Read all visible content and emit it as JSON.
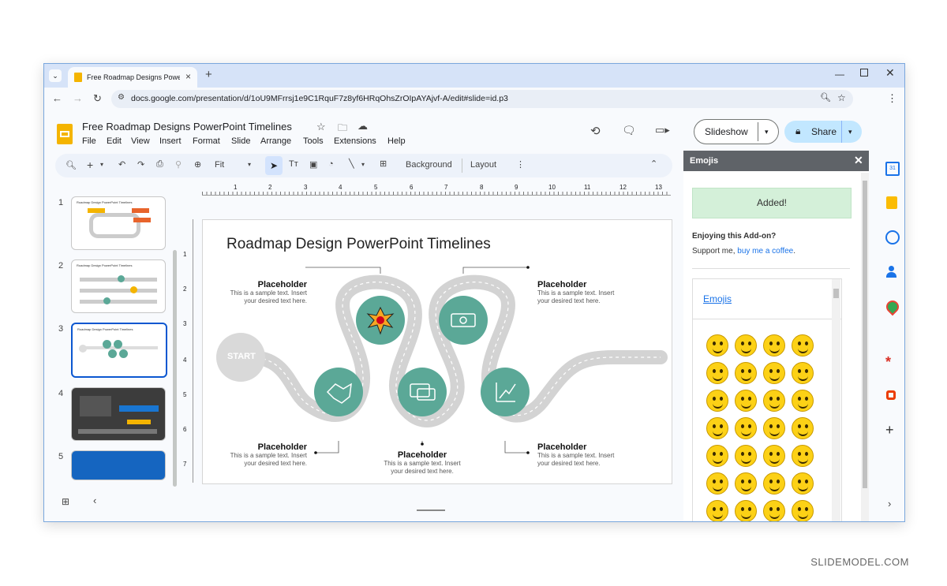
{
  "browser": {
    "tab_title": "Free Roadmap Designs PowerPoint",
    "url": "docs.google.com/presentation/d/1oU9MFrrsj1e9C1RquF7z8yf6HRqOhsZrOIpAYAjvf-A/edit#slide=id.p3"
  },
  "doc": {
    "title": "Free Roadmap Designs PowerPoint Timelines",
    "menus": [
      "File",
      "Edit",
      "View",
      "Insert",
      "Format",
      "Slide",
      "Arrange",
      "Tools",
      "Extensions",
      "Help"
    ],
    "slideshow_label": "Slideshow",
    "share_label": "Share"
  },
  "toolbar": {
    "zoom_label": "Fit",
    "background_label": "Background",
    "layout_label": "Layout"
  },
  "ruler": {
    "ticks": [
      "1",
      "2",
      "3",
      "4",
      "5",
      "6",
      "7",
      "8",
      "9",
      "10",
      "11",
      "12",
      "13"
    ],
    "vticks": [
      "1",
      "2",
      "3",
      "4",
      "5",
      "6",
      "7"
    ]
  },
  "thumbnails": [
    {
      "num": "1",
      "title": "Roadmap Design PowerPoint Timelines"
    },
    {
      "num": "2",
      "title": "Roadmap Design PowerPoint Timelines"
    },
    {
      "num": "3",
      "title": "Roadmap Design PowerPoint Timelines"
    },
    {
      "num": "4",
      "title": ""
    },
    {
      "num": "5",
      "title": ""
    }
  ],
  "slide": {
    "title": "Roadmap Design PowerPoint Timelines",
    "start_label": "START",
    "placeholders": [
      {
        "heading": "Placeholder",
        "text": "This is a sample text. Insert your desired text here."
      },
      {
        "heading": "Placeholder",
        "text": "This is a sample text. Insert your desired text here."
      },
      {
        "heading": "Placeholder",
        "text": "This is a sample text. Insert your desired text here."
      },
      {
        "heading": "Placeholder",
        "text": "This is a sample text. Insert your desired text here."
      },
      {
        "heading": "Placeholder",
        "text": "This is a sample text. Insert your desired text here."
      }
    ],
    "colors": {
      "circle": "#5ba897",
      "road": "#d0d0d0",
      "start": "#d9d9d9"
    }
  },
  "panel": {
    "title": "Emojis",
    "added": "Added!",
    "enjoying": "Enjoying this Add-on?",
    "support_prefix": "Support me, ",
    "support_link": "buy me a coffee",
    "support_suffix": ".",
    "emojis_link": "Emojis"
  },
  "watermark": "SLIDEMODEL.COM"
}
